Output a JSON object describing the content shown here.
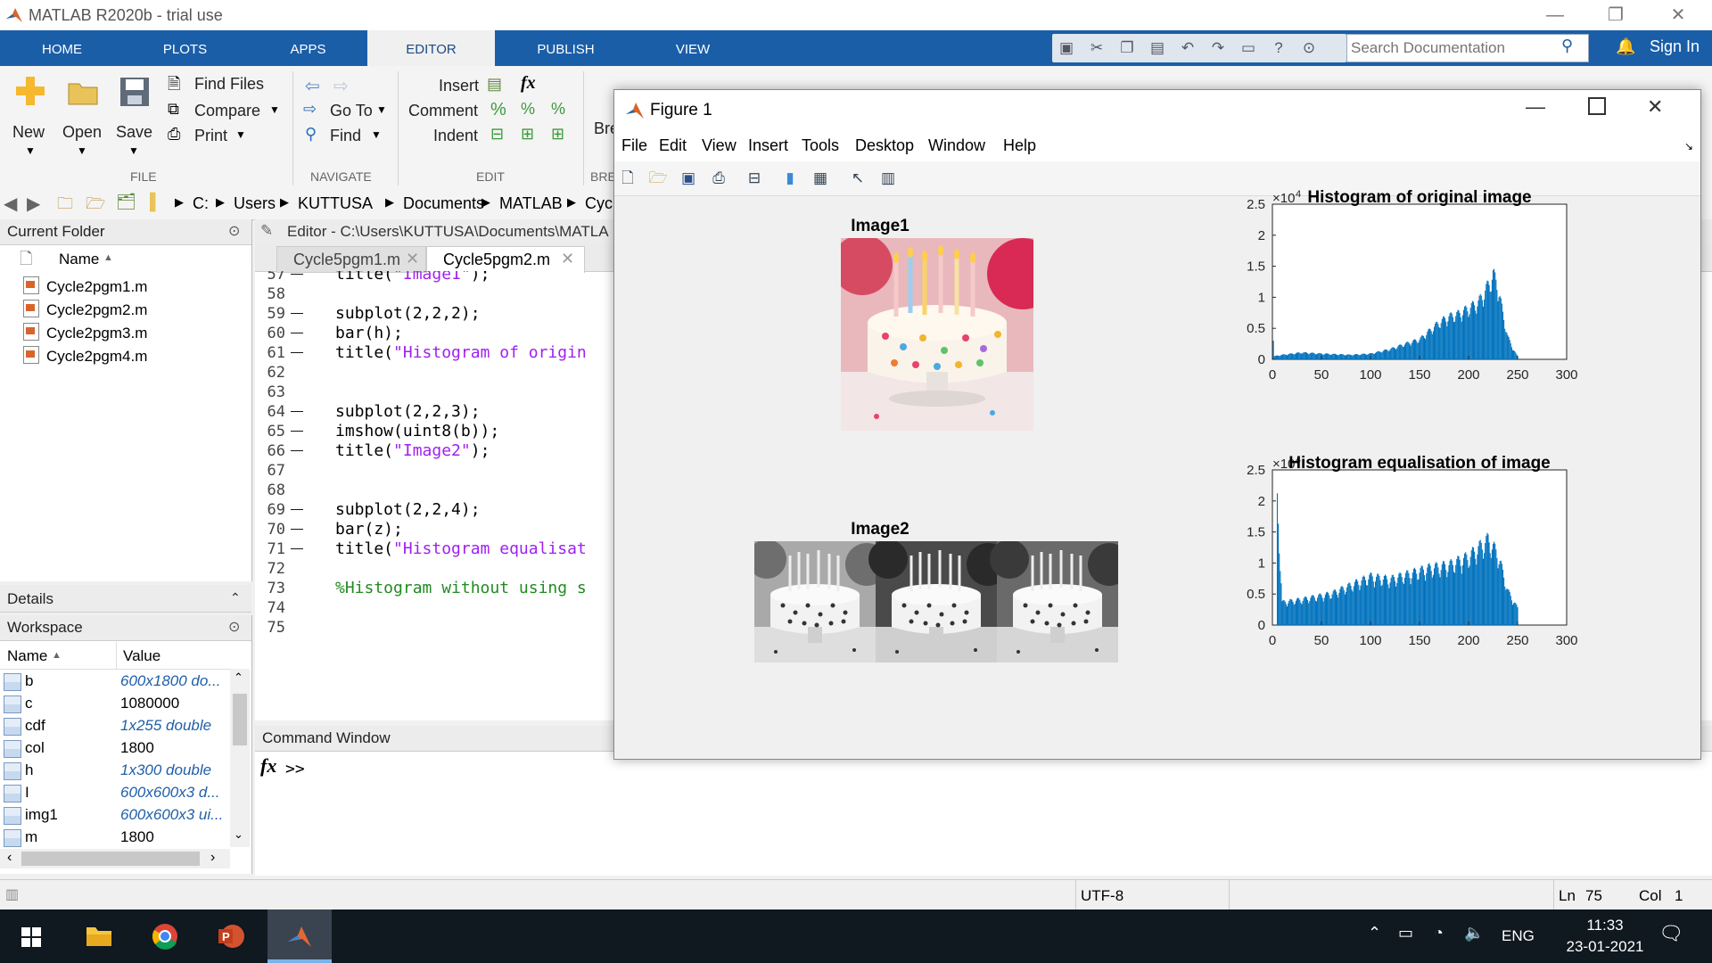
{
  "app_title": "MATLAB R2020b - trial use",
  "window_controls": {
    "minimize": "—",
    "restore": "❐",
    "close": "✕"
  },
  "tabs": [
    "HOME",
    "PLOTS",
    "APPS",
    "EDITOR",
    "PUBLISH",
    "VIEW"
  ],
  "active_tab": "EDITOR",
  "search": {
    "placeholder": "Search Documentation"
  },
  "sign_in": "Sign In",
  "ribbon": {
    "file": {
      "new": "New",
      "open": "Open",
      "save": "Save",
      "find_files": "Find Files",
      "compare": "Compare",
      "print": "Print",
      "group": "FILE"
    },
    "navigate": {
      "go_to": "Go To",
      "find": "Find",
      "group": "NAVIGATE"
    },
    "edit": {
      "insert": "Insert",
      "comment": "Comment",
      "indent": "Indent",
      "group": "EDIT"
    },
    "bre": {
      "label": "Bre",
      "group": "BRE"
    }
  },
  "path": [
    "C:",
    "Users",
    "KUTTUSA",
    "Documents",
    "MATLAB",
    "Cycl"
  ],
  "current_folder": {
    "title": "Current Folder",
    "column": "Name",
    "files": [
      "Cycle2pgm1.m",
      "Cycle2pgm2.m",
      "Cycle2pgm3.m",
      "Cycle2pgm4.m"
    ]
  },
  "details": {
    "title": "Details"
  },
  "workspace": {
    "title": "Workspace",
    "col_name": "Name",
    "col_value": "Value",
    "rows": [
      {
        "name": "b",
        "value": "600x1800 do...",
        "italic": true
      },
      {
        "name": "c",
        "value": "1080000",
        "italic": false
      },
      {
        "name": "cdf",
        "value": "1x255 double",
        "italic": true
      },
      {
        "name": "col",
        "value": "1800",
        "italic": false
      },
      {
        "name": "h",
        "value": "1x300 double",
        "italic": true
      },
      {
        "name": "I",
        "value": "600x600x3 d...",
        "italic": true
      },
      {
        "name": "img1",
        "value": "600x600x3 ui...",
        "italic": true
      },
      {
        "name": "m",
        "value": "1800",
        "italic": false
      }
    ]
  },
  "editor": {
    "title": "Editor - C:\\Users\\KUTTUSA\\Documents\\MATLA",
    "tabs": [
      "Cycle5pgm1.m",
      "Cycle5pgm2.m"
    ],
    "lines": [
      {
        "n": "57",
        "dash": "—",
        "plain": "title(",
        "str": "\"Image1\"",
        "tail": ");"
      },
      {
        "n": "58",
        "dash": "",
        "plain": "",
        "str": "",
        "tail": ""
      },
      {
        "n": "59",
        "dash": "—",
        "plain": "subplot(2,2,2);",
        "str": "",
        "tail": ""
      },
      {
        "n": "60",
        "dash": "—",
        "plain": "bar(h);",
        "str": "",
        "tail": ""
      },
      {
        "n": "61",
        "dash": "—",
        "plain": "title(",
        "str": "\"Histogram of origin",
        "tail": ""
      },
      {
        "n": "62",
        "dash": "",
        "plain": "",
        "str": "",
        "tail": ""
      },
      {
        "n": "63",
        "dash": "",
        "plain": "",
        "str": "",
        "tail": ""
      },
      {
        "n": "64",
        "dash": "—",
        "plain": "subplot(2,2,3);",
        "str": "",
        "tail": ""
      },
      {
        "n": "65",
        "dash": "—",
        "plain": "imshow(uint8(b));",
        "str": "",
        "tail": ""
      },
      {
        "n": "66",
        "dash": "—",
        "plain": "title(",
        "str": "\"Image2\"",
        "tail": ");"
      },
      {
        "n": "67",
        "dash": "",
        "plain": "",
        "str": "",
        "tail": ""
      },
      {
        "n": "68",
        "dash": "",
        "plain": "",
        "str": "",
        "tail": ""
      },
      {
        "n": "69",
        "dash": "—",
        "plain": "subplot(2,2,4);",
        "str": "",
        "tail": ""
      },
      {
        "n": "70",
        "dash": "—",
        "plain": "bar(z);",
        "str": "",
        "tail": ""
      },
      {
        "n": "71",
        "dash": "—",
        "plain": "title(",
        "str": "\"Histogram equalisat",
        "tail": ""
      },
      {
        "n": "72",
        "dash": "",
        "plain": "",
        "str": "",
        "tail": ""
      },
      {
        "n": "73",
        "dash": "",
        "plain": "",
        "str": "",
        "tail": "",
        "comment": "%Histogram without using s"
      },
      {
        "n": "74",
        "dash": "",
        "plain": "",
        "str": "",
        "tail": ""
      },
      {
        "n": "75",
        "dash": "",
        "plain": "",
        "str": "",
        "tail": ""
      }
    ]
  },
  "command_window": {
    "title": "Command Window",
    "fx": "fx",
    "prompt": ">>"
  },
  "status": {
    "encoding": "UTF-8",
    "ln_label": "Ln",
    "ln": "75",
    "col_label": "Col",
    "col": "1"
  },
  "figure": {
    "title": "Figure 1",
    "menu": [
      "File",
      "Edit",
      "View",
      "Insert",
      "Tools",
      "Desktop",
      "Window",
      "Help"
    ],
    "subplots": {
      "image1_title": "Image1",
      "image2_title": "Image2"
    }
  },
  "chart_data": [
    {
      "type": "bar",
      "title": "Histogram of original image",
      "exponent_label": "×10",
      "exponent": "4",
      "xlim": [
        0,
        300
      ],
      "ylim": [
        0,
        2.5
      ],
      "xticks": [
        "0",
        "50",
        "100",
        "150",
        "200",
        "250",
        "300"
      ],
      "yticks": [
        "0",
        "0.5",
        "1",
        "1.5",
        "2",
        "2.5"
      ],
      "xlabel": "",
      "ylabel": "",
      "color": "#0072bd",
      "envelope": [
        [
          0,
          0.05
        ],
        [
          10,
          0.08
        ],
        [
          30,
          0.12
        ],
        [
          50,
          0.1
        ],
        [
          80,
          0.08
        ],
        [
          100,
          0.1
        ],
        [
          120,
          0.18
        ],
        [
          140,
          0.3
        ],
        [
          150,
          0.35
        ],
        [
          160,
          0.5
        ],
        [
          170,
          0.65
        ],
        [
          180,
          0.75
        ],
        [
          190,
          0.8
        ],
        [
          200,
          0.9
        ],
        [
          210,
          1.0
        ],
        [
          220,
          1.3
        ],
        [
          225,
          1.5
        ],
        [
          230,
          1.3
        ],
        [
          235,
          0.8
        ],
        [
          240,
          0.4
        ],
        [
          245,
          0.2
        ],
        [
          250,
          0.05
        ]
      ]
    },
    {
      "type": "bar",
      "title": "Histogram equalisation of image",
      "exponent_label": "×10",
      "exponent": "4",
      "xlim": [
        0,
        300
      ],
      "ylim": [
        0,
        2.5
      ],
      "xticks": [
        "0",
        "50",
        "100",
        "150",
        "200",
        "250",
        "300"
      ],
      "yticks": [
        "0",
        "0.5",
        "1",
        "1.5",
        "2",
        "2.5"
      ],
      "xlabel": "",
      "ylabel": "",
      "color": "#0072bd",
      "envelope": [
        [
          5,
          2.2
        ],
        [
          10,
          0.4
        ],
        [
          30,
          0.45
        ],
        [
          60,
          0.55
        ],
        [
          80,
          0.7
        ],
        [
          100,
          0.85
        ],
        [
          120,
          0.8
        ],
        [
          140,
          0.9
        ],
        [
          160,
          1.0
        ],
        [
          180,
          1.05
        ],
        [
          200,
          1.2
        ],
        [
          210,
          1.35
        ],
        [
          220,
          1.5
        ],
        [
          230,
          1.25
        ],
        [
          240,
          0.6
        ],
        [
          250,
          0.3
        ]
      ]
    }
  ],
  "taskbar": {
    "lang": "ENG",
    "time": "11:33",
    "date": "23-01-2021"
  }
}
